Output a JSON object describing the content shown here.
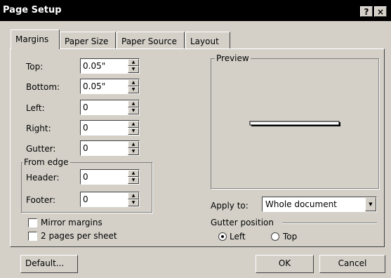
{
  "window": {
    "title": "Page Setup",
    "help_label": "?",
    "close_label": "×"
  },
  "tabs": [
    {
      "label": "Margins",
      "active": true
    },
    {
      "label": "Paper Size"
    },
    {
      "label": "Paper Source"
    },
    {
      "label": "Layout"
    }
  ],
  "margins": {
    "top": {
      "label": "Top:",
      "value": "0.05\""
    },
    "bottom": {
      "label": "Bottom:",
      "value": "0.05\""
    },
    "left": {
      "label": "Left:",
      "value": "0"
    },
    "right": {
      "label": "Right:",
      "value": "0"
    },
    "gutter": {
      "label": "Gutter:",
      "value": "0"
    }
  },
  "from_edge": {
    "title": "From edge",
    "header": {
      "label": "Header:",
      "value": "0"
    },
    "footer": {
      "label": "Footer:",
      "value": "0"
    }
  },
  "options": {
    "mirror_margins": {
      "label": "Mirror margins",
      "checked": false
    },
    "two_pages": {
      "label": "2 pages per sheet",
      "checked": false
    }
  },
  "preview": {
    "title": "Preview"
  },
  "apply_to": {
    "label": "Apply to:",
    "value": "Whole document"
  },
  "gutter_position": {
    "title": "Gutter position",
    "left": {
      "label": "Left",
      "selected": true
    },
    "top": {
      "label": "Top",
      "selected": false
    }
  },
  "buttons": {
    "default": "Default...",
    "ok": "OK",
    "cancel": "Cancel"
  },
  "colors": {
    "face": "#d4d0c8",
    "title_bar": "#000000",
    "shadow": "#404040",
    "highlight": "#ffffff"
  }
}
